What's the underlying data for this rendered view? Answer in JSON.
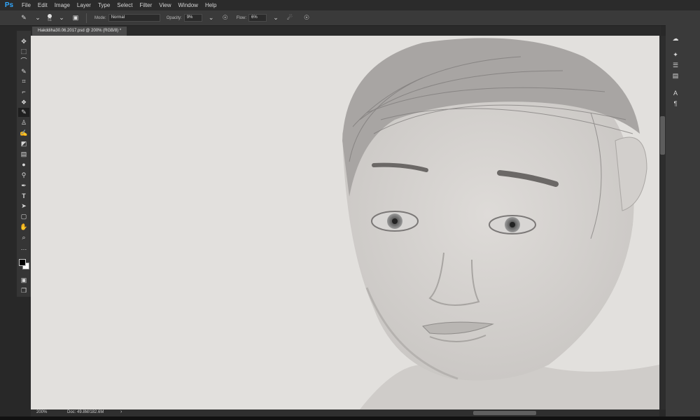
{
  "app": {
    "logo": "Ps"
  },
  "menu": [
    "File",
    "Edit",
    "Image",
    "Layer",
    "Type",
    "Select",
    "Filter",
    "View",
    "Window",
    "Help"
  ],
  "options": {
    "brush_size": "51",
    "mode_label": "Mode:",
    "mode_value": "Normal",
    "opacity_label": "Opacity:",
    "opacity_value": "9%",
    "flow_label": "Flow:",
    "flow_value": "6%"
  },
  "document": {
    "tab_title": "Hakddiha30.06.2017.psd @ 200% (RGB/8) *"
  },
  "status": {
    "zoom": "200%",
    "doc_info": "Doc: 49.8M/182.6M"
  },
  "tools": [
    "move-icon",
    "marquee-icon",
    "lasso-icon",
    "quick-select-icon",
    "crop-icon",
    "eyedropper-icon",
    "healing-icon",
    "brush-icon",
    "stamp-icon",
    "history-brush-icon",
    "eraser-icon",
    "gradient-icon",
    "blur-icon",
    "dodge-icon",
    "pen-icon",
    "type-icon",
    "path-select-icon",
    "rectangle-icon",
    "hand-icon",
    "zoom-icon",
    "more-icon"
  ],
  "colors": {
    "canvas": "#e2e0dd",
    "chrome": "#3a3a3a",
    "menubar": "#2b2b2b",
    "accent": "#31a8ff"
  }
}
